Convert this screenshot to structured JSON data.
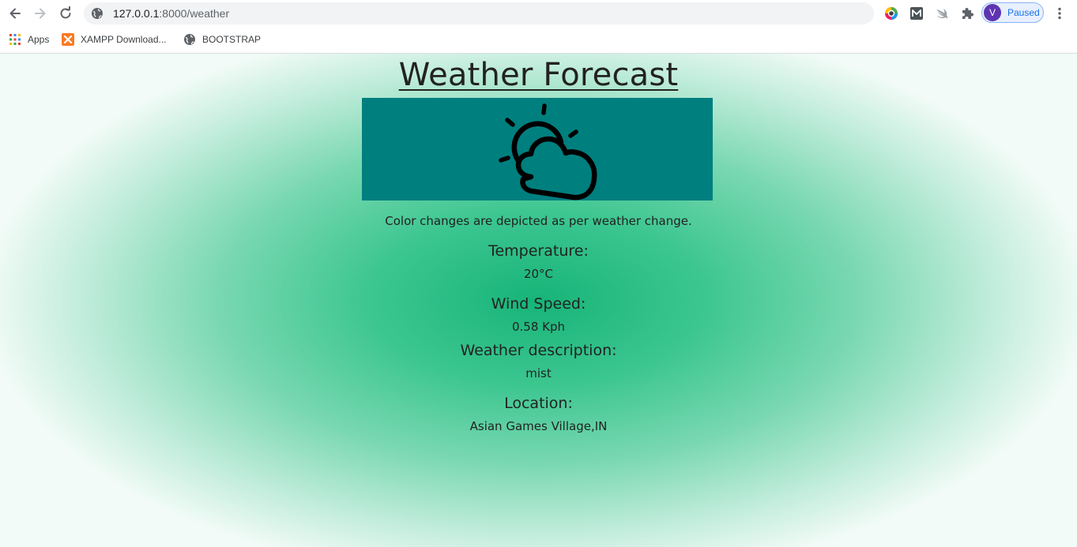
{
  "browser": {
    "url_host": "127.0.0.1",
    "url_path": ":8000/weather",
    "profile_initial": "V",
    "profile_status": "Paused",
    "icons": [
      "back-arrow-icon",
      "forward-arrow-icon",
      "reload-icon",
      "globe-icon",
      "color-wheel-icon",
      "m-logo-icon",
      "swift-icon",
      "puzzle-icon",
      "kebab-menu-icon"
    ],
    "accent_color": "#1a73e8"
  },
  "bookmarks": [
    {
      "label": "Apps",
      "icon": "apps-grid-icon"
    },
    {
      "label": "XAMPP Download...",
      "icon": "xampp-icon"
    },
    {
      "label": "BOOTSTRAP",
      "icon": "globe-icon"
    }
  ],
  "page": {
    "title": "Weather Forecast",
    "banner_color": "#007f7f",
    "banner_icon": "sun-behind-cloud-icon",
    "caption": "Color changes are depicted as per weather change.",
    "fields": {
      "temperature": {
        "label": "Temperature:",
        "value": "20°C"
      },
      "wind_speed": {
        "label": "Wind Speed:",
        "value": "0.58 Kph"
      },
      "description": {
        "label": "Weather description:",
        "value": "mist"
      },
      "location": {
        "label": "Location:",
        "value": "Asian Games Village,IN"
      }
    },
    "background_color": "#17b478"
  }
}
